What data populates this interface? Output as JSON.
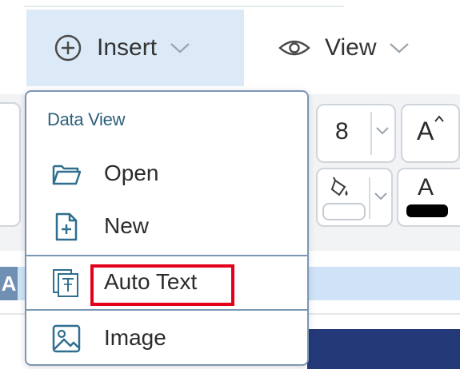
{
  "ribbon": {
    "tabs": [
      {
        "label": "Insert",
        "icon": "plus-circle-icon",
        "active": true
      },
      {
        "label": "View",
        "icon": "eye-icon",
        "active": false
      }
    ]
  },
  "toolbar": {
    "font_size": "8",
    "grow_font_glyph": "A",
    "font_color_glyph": "A",
    "font_color": "#000000",
    "fill_color": "#ffffff"
  },
  "document": {
    "row_marker": "A",
    "highlight_color": "#cfe2f7"
  },
  "insert_menu": {
    "header": "Data View",
    "items": [
      {
        "label": "Open",
        "icon": "folder-open-icon"
      },
      {
        "label": "New",
        "icon": "new-file-icon"
      },
      {
        "label": "Auto Text",
        "icon": "auto-text-icon",
        "highlighted": true
      },
      {
        "label": "Image",
        "icon": "image-icon"
      }
    ],
    "accent_color": "#2c5f7c",
    "highlight_box_color": "#e3001b"
  }
}
